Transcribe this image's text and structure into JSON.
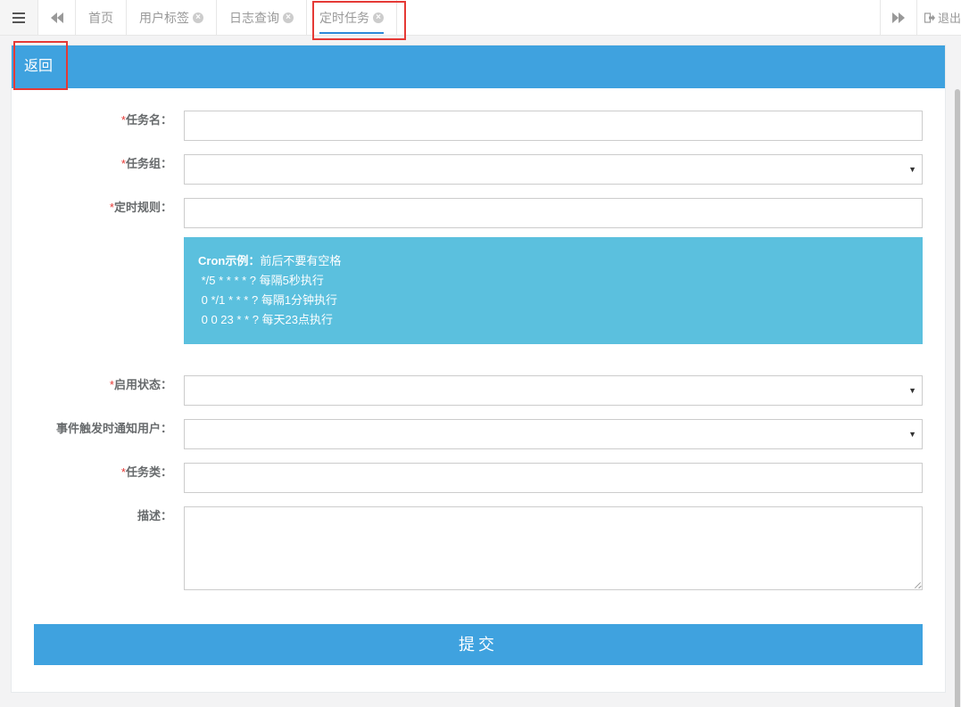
{
  "topbar": {
    "tabs": [
      {
        "label": "首页",
        "closable": false
      },
      {
        "label": "用户标签",
        "closable": true
      },
      {
        "label": "日志查询",
        "closable": true
      },
      {
        "label": "定时任务",
        "closable": true,
        "active": true
      }
    ],
    "logout_label": "退出"
  },
  "panel": {
    "back_label": "返回"
  },
  "form": {
    "task_name_label": "任务名：",
    "task_group_label": "任务组：",
    "cron_label": "定时规则：",
    "status_label": "启用状态：",
    "notify_label": "事件触发时通知用户：",
    "task_class_label": "任务类：",
    "desc_label": "描述：",
    "required_mark": "*",
    "task_name_value": "",
    "task_group_value": "",
    "cron_value": "",
    "status_value": "",
    "notify_value": "",
    "task_class_value": "",
    "desc_value": ""
  },
  "cron_help": {
    "title": "Cron示例：",
    "title_suffix": "前后不要有空格",
    "lines": [
      " */5 * * * * ? 每隔5秒执行",
      " 0 */1 * * * ? 每隔1分钟执行",
      " 0 0 23 * * ? 每天23点执行"
    ]
  },
  "submit_label": "提交",
  "colors": {
    "primary": "#3fa2df",
    "info": "#5bc0de",
    "highlight": "#e53935"
  }
}
